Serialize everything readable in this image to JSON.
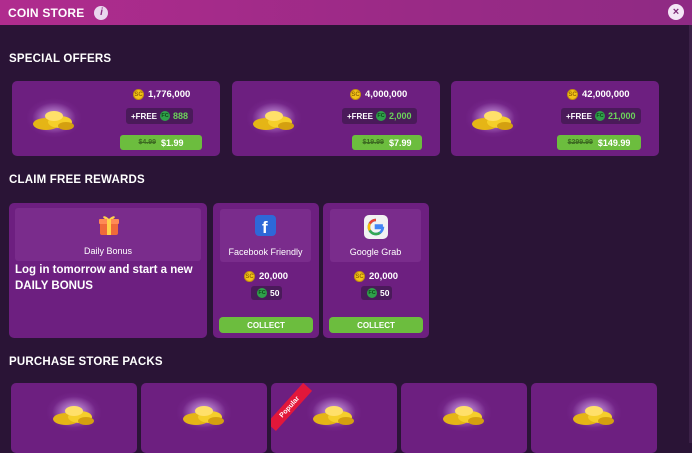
{
  "header": {
    "title": "COIN STORE",
    "info_icon": "i",
    "close_icon": "×"
  },
  "sections": {
    "special_offers": "SPECIAL OFFERS",
    "claim_free_rewards": "CLAIM FREE REWARDS",
    "purchase_store_packs": "PURCHASE STORE PACKS"
  },
  "offers": [
    {
      "coins": "1,776,000",
      "free_prefix": "+FREE",
      "free_amount": "888",
      "old_price": "$4.99",
      "price": "$1.99"
    },
    {
      "coins": "4,000,000",
      "free_prefix": "+FREE",
      "free_amount": "2,000",
      "old_price": "$19.99",
      "price": "$7.99"
    },
    {
      "coins": "42,000,000",
      "free_prefix": "+FREE",
      "free_amount": "21,000",
      "old_price": "$299.99",
      "price": "$149.99"
    }
  ],
  "daily_bonus": {
    "label": "Daily Bonus",
    "message": "Log in tomorrow and start a new DAILY BONUS"
  },
  "rewards": [
    {
      "label": "Facebook Friendly",
      "coins": "20,000",
      "gems": "50",
      "button": "COLLECT",
      "icon": "facebook-icon"
    },
    {
      "label": "Google Grab",
      "coins": "20,000",
      "gems": "50",
      "button": "COLLECT",
      "icon": "google-icon"
    }
  ],
  "packs": [
    {
      "badge": ""
    },
    {
      "badge": ""
    },
    {
      "badge": "Popular"
    },
    {
      "badge": ""
    },
    {
      "badge": ""
    }
  ],
  "icon_glyphs": {
    "coin": "SC",
    "gem": "FC"
  },
  "colors": {
    "accent_green": "#6cbd3e",
    "panel": "#6d1f80",
    "background": "#2a1436",
    "header": "#9a2a86"
  }
}
